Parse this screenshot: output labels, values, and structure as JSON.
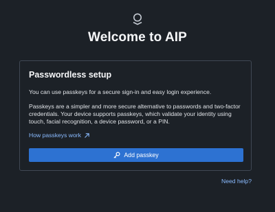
{
  "header": {
    "logo_icon": "palantir-logo-icon",
    "title": "Welcome to AIP"
  },
  "card": {
    "title": "Passwordless setup",
    "intro": "You can use passkeys for a secure sign-in and easy login experience.",
    "description_lines": [
      "Passkeys are a simpler and more secure alternative to passwords and two-factor",
      "credentials. Your device supports passkeys, which validate your identity using",
      "touch, facial recognition, a device password, or a PIN."
    ],
    "link_label": "How passkeys work",
    "link_icon": "arrow-top-right-icon",
    "button_label": "Add passkey",
    "button_icon": "key-icon"
  },
  "footer": {
    "help_label": "Need help?"
  },
  "colors": {
    "background": "#1c2127",
    "card_border": "#404854",
    "accent": "#2d72d2",
    "link": "#8abbff",
    "text": "#f6f7f9"
  }
}
